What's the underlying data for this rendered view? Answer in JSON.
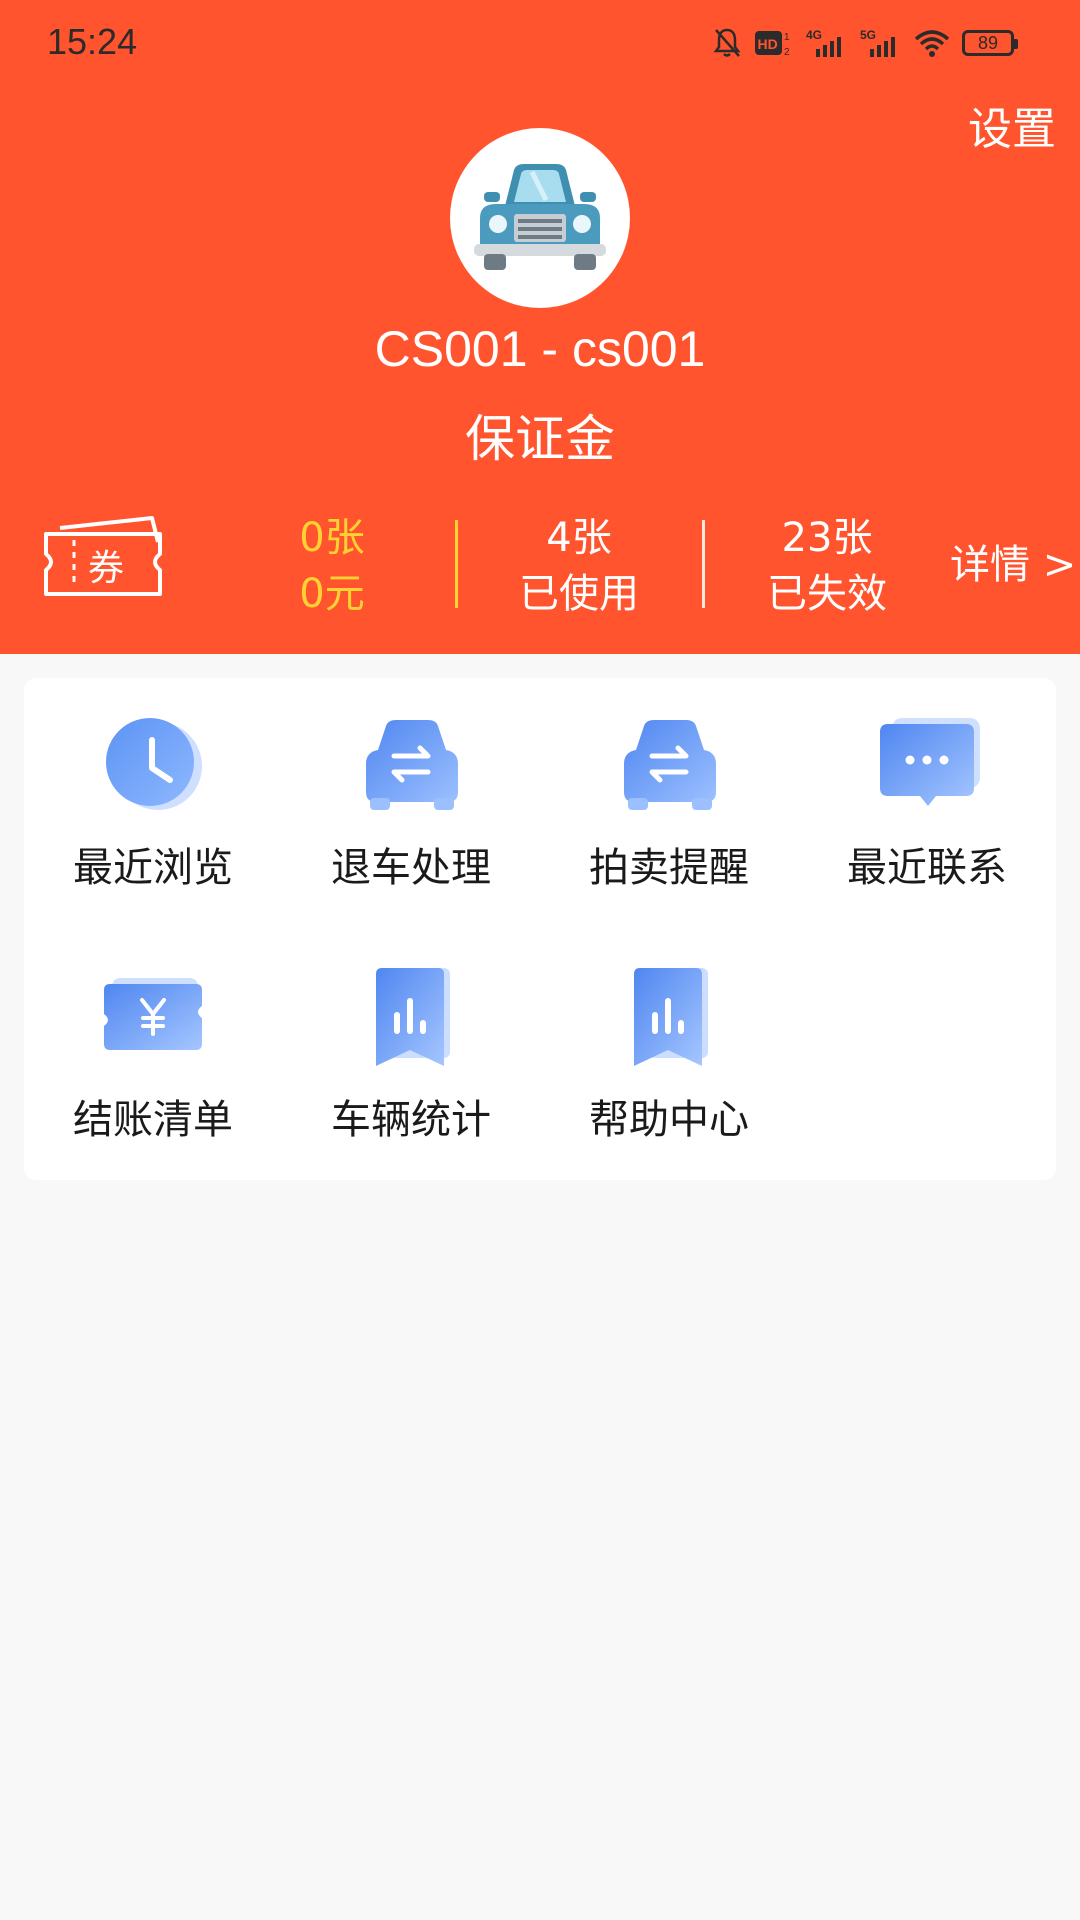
{
  "status_bar": {
    "time": "15:24",
    "network_1": "4G",
    "network_2": "5G",
    "battery": "89"
  },
  "header": {
    "settings_label": "设置",
    "username": "CS001 - cs001",
    "deposit_label": "保证金",
    "coupon_icon_text": "券",
    "stats": {
      "unused_count": "0张",
      "unused_amount": "0元",
      "used_count": "4张",
      "used_label": "已使用",
      "expired_count": "23张",
      "expired_label": "已失效"
    },
    "details_label": "详情 >",
    "colors": {
      "brand": "#ff542d",
      "highlight": "#ffd233"
    }
  },
  "menu": {
    "items": [
      {
        "label": "最近浏览",
        "icon": "clock-icon"
      },
      {
        "label": "退车处理",
        "icon": "car-exchange-icon"
      },
      {
        "label": "拍卖提醒",
        "icon": "car-exchange-icon"
      },
      {
        "label": "最近联系",
        "icon": "chat-bubble-icon"
      },
      {
        "label": "结账清单",
        "icon": "yuan-ticket-icon"
      },
      {
        "label": "车辆统计",
        "icon": "bar-chart-bookmark-icon"
      },
      {
        "label": "帮助中心",
        "icon": "bar-chart-bookmark-icon"
      }
    ]
  }
}
